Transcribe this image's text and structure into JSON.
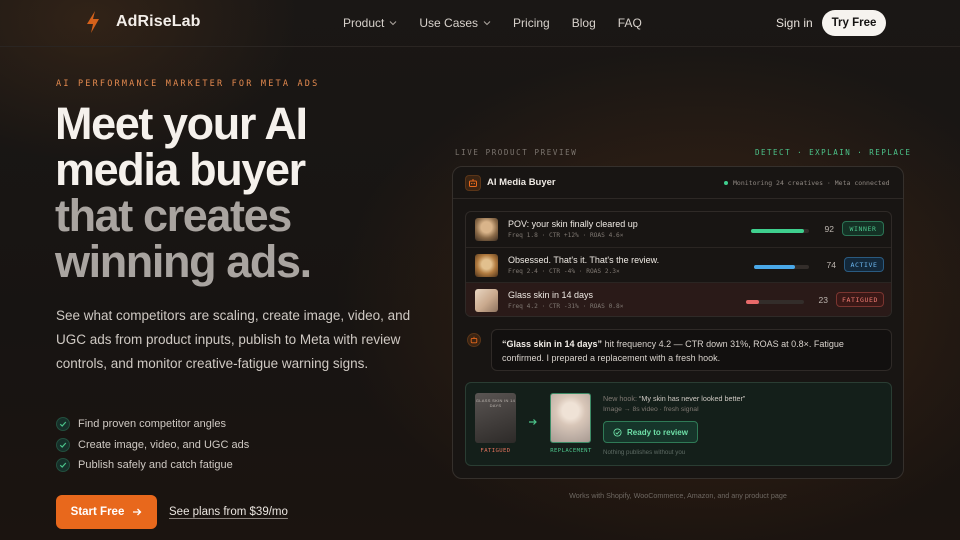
{
  "brand": {
    "name": "AdRiseLab",
    "logo_icon": "bolt-icon",
    "accent": "#e8681c"
  },
  "nav": {
    "items": [
      {
        "label": "Product",
        "dropdown": true
      },
      {
        "label": "Use Cases",
        "dropdown": true
      },
      {
        "label": "Pricing",
        "dropdown": false
      },
      {
        "label": "Blog",
        "dropdown": false
      },
      {
        "label": "FAQ",
        "dropdown": false
      }
    ],
    "sign_in": "Sign in",
    "try_free": "Try Free"
  },
  "hero": {
    "eyebrow": "AI PERFORMANCE MARKETER FOR META ADS",
    "headline": [
      "Meet your AI",
      "media buyer",
      "that creates",
      "winning ads."
    ],
    "subtext": "See what competitors are scaling, create image, video, and UGC ads from product inputs, publish to Meta with review controls, and monitor creative-fatigue warning signs.",
    "checks": [
      "Find proven competitor angles",
      "Create image, video, and UGC ads",
      "Publish safely and catch fatigue"
    ],
    "cta_primary": "Start Free",
    "cta_secondary": "See plans from $39/mo"
  },
  "preview": {
    "label": "LIVE PRODUCT PREVIEW",
    "steps": "DETECT · EXPLAIN · REPLACE",
    "title": "AI Media Buyer",
    "status": "Monitoring 24 creatives · Meta connected",
    "creatives": [
      {
        "title": "POV: your skin finally cleared up",
        "meta": "Freq 1.8 · CTR +12% · ROAS 4.6×",
        "score": 92,
        "progress": 0.92,
        "badge": "WINNER",
        "bar_color": "#3fcf8e",
        "badge_color": "#4cc38a"
      },
      {
        "title": "Obsessed. That's it. That's the review.",
        "meta": "Freq 2.4 · CTR -4% · ROAS 2.3×",
        "score": 74,
        "progress": 0.74,
        "badge": "ACTIVE",
        "bar_color": "#4aa8e8",
        "badge_color": "#6cb6ee"
      },
      {
        "title": "Glass skin in 14 days",
        "meta": "Freq 4.2 · CTR -31% · ROAS 0.8×",
        "score": 23,
        "progress": 0.23,
        "badge": "FATIGUED",
        "bar_color": "#e86a6a",
        "badge_color": "#ee7b72"
      }
    ],
    "message": {
      "quote": "“Glass skin in 14 days”",
      "rest": " hit frequency 4.2 — CTR down 31%, ROAS at 0.8×. Fatigue confirmed. I prepared a replacement with a fresh hook."
    },
    "replacement": {
      "old_thumb_text": "GLASS SKIN IN 14 DAYS",
      "fatigued_label": "FATIGUED",
      "replacement_label": "REPLACEMENT",
      "new_hook_label": "New hook:",
      "new_hook": "“My skin has never looked better”",
      "meta": "Image → 8s video · fresh signal",
      "ready": "Ready to review",
      "nothing": "Nothing publishes without you"
    },
    "works_with": "Works with Shopify, WooCommerce, Amazon, and any product page"
  }
}
